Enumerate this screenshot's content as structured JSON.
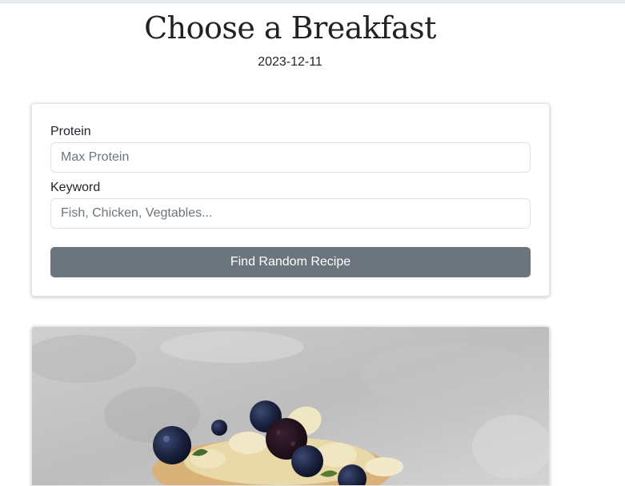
{
  "header": {
    "title": "Choose a Breakfast",
    "date": "2023-12-11"
  },
  "form": {
    "protein_label": "Protein",
    "protein_placeholder": "Max Protein",
    "keyword_label": "Keyword",
    "keyword_placeholder": "Fish, Chicken, Vegtables...",
    "submit_label": "Find Random Recipe"
  },
  "recipe": {
    "image_name": "pancakes-with-blueberries-and-banana"
  },
  "colors": {
    "button_bg": "#6c757d",
    "button_text": "#ffffff",
    "text": "#212529"
  }
}
